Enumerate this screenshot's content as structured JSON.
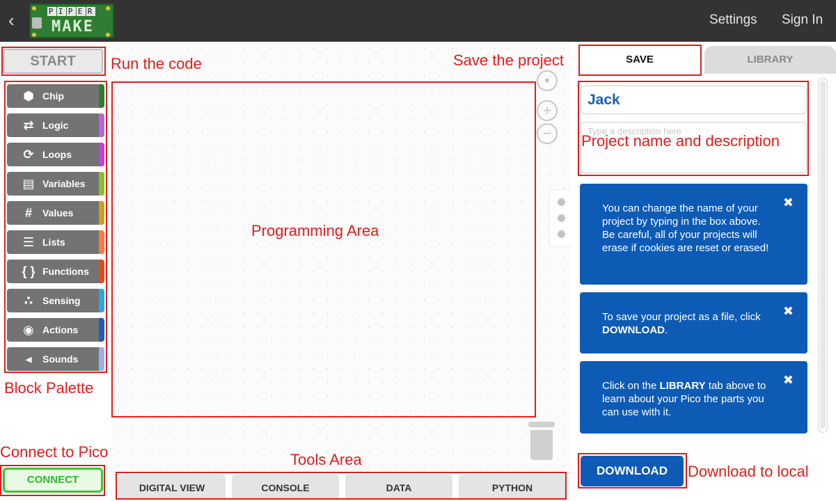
{
  "header": {
    "back_icon": "chevron-left-icon",
    "logo_text_top": "PIPER",
    "logo_text_bottom": "MAKE",
    "settings_label": "Settings",
    "signin_label": "Sign In",
    "bg_color": "#333333"
  },
  "palette": {
    "start_label": "START",
    "categories": [
      {
        "label": "Chip",
        "icon": "hexagon-icon",
        "color": "#2e7d32"
      },
      {
        "label": "Logic",
        "icon": "shuffle-icon",
        "color": "#b36ad9"
      },
      {
        "label": "Loops",
        "icon": "loop-arrow-icon",
        "color": "#c040e0"
      },
      {
        "label": "Variables",
        "icon": "variable-box-icon",
        "color": "#8bbd2a"
      },
      {
        "label": "Values",
        "icon": "hash-icon",
        "color": "#c9a21c"
      },
      {
        "label": "Lists",
        "icon": "list-icon",
        "color": "#ff7a3d"
      },
      {
        "label": "Functions",
        "icon": "braces-icon",
        "color": "#e04d1a"
      },
      {
        "label": "Sensing",
        "icon": "sensor-dots-icon",
        "color": "#29a8e6"
      },
      {
        "label": "Actions",
        "icon": "target-icon",
        "color": "#1a5fb4"
      },
      {
        "label": "Sounds",
        "icon": "speaker-icon",
        "color": "#9faee8"
      }
    ],
    "connect_label": "CONNECT"
  },
  "workspace": {
    "recenter_icon": "crosshair-icon",
    "zoom_in_icon": "zoom-in-icon",
    "zoom_out_icon": "zoom-out-icon",
    "trash_icon": "trash-icon"
  },
  "tools": {
    "tabs": [
      "DIGITAL VIEW",
      "CONSOLE",
      "DATA",
      "PYTHON"
    ]
  },
  "project": {
    "tab_save": "SAVE",
    "tab_library": "LIBRARY",
    "name_value": "Jack",
    "description_placeholder": "Type a description here",
    "cards": [
      {
        "text_html": "You can change the name of your project by typing in the box above. Be careful, all of your projects will erase if cookies are reset or erased!"
      },
      {
        "text_html": "To save your project as a file, click <b>DOWNLOAD</b>."
      },
      {
        "text_html": "Click on the <b>LIBRARY</b> tab above to learn about your Pico the parts you can use with it."
      }
    ],
    "download_label": "DOWNLOAD",
    "accent_color": "#0d5bb5"
  },
  "annotations": {
    "run_code": "Run the code",
    "block_palette": "Block Palette",
    "connect_pico": "Connect to Pico",
    "programming_area": "Programming Area",
    "tools_area": "Tools Area",
    "save_project": "Save the project",
    "name_description": "Project name and description",
    "download_local": "Download to local",
    "color": "#e31c1c"
  }
}
